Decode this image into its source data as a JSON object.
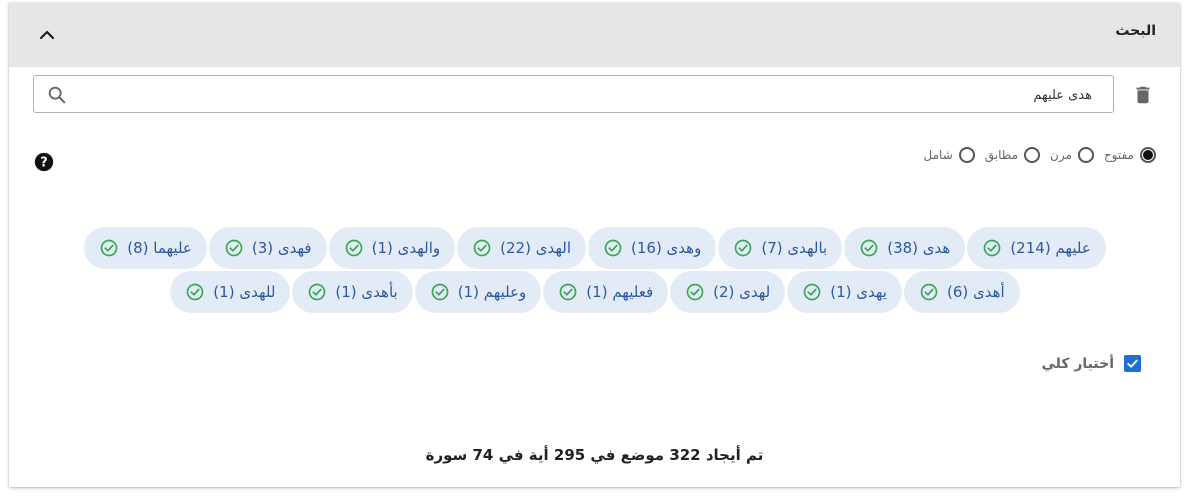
{
  "panel": {
    "title": "البحث"
  },
  "search": {
    "value": "هدى عليهم",
    "placeholder": ""
  },
  "modes": [
    {
      "label": "مفتوح",
      "selected": true
    },
    {
      "label": "مرن",
      "selected": false
    },
    {
      "label": "مطابق",
      "selected": false
    },
    {
      "label": "شامل",
      "selected": false
    }
  ],
  "chips_row1": [
    {
      "label": "عليهم (214)"
    },
    {
      "label": "هدى (38)"
    },
    {
      "label": "بالهدى (7)"
    },
    {
      "label": "وهدى (16)"
    },
    {
      "label": "الهدى (22)"
    },
    {
      "label": "والهدى (1)"
    },
    {
      "label": "فهدى (3)"
    },
    {
      "label": "عليهما (8)"
    }
  ],
  "chips_row2": [
    {
      "label": "أهدى (6)"
    },
    {
      "label": "يهدى (1)"
    },
    {
      "label": "لهدى (2)"
    },
    {
      "label": "فعليهم (1)"
    },
    {
      "label": "وعليهم (1)"
    },
    {
      "label": "بأهدى (1)"
    },
    {
      "label": "للهدى (1)"
    }
  ],
  "select_all": {
    "label": "أختيار كلي",
    "checked": true
  },
  "summary": "تم أيجاد 322 موضع في 295 أية في 74 سورة",
  "colors": {
    "accent": "#1f6fd0",
    "chip_bg": "#e3ebf6",
    "chip_text": "#2c5aa0",
    "check": "#3aa655"
  }
}
